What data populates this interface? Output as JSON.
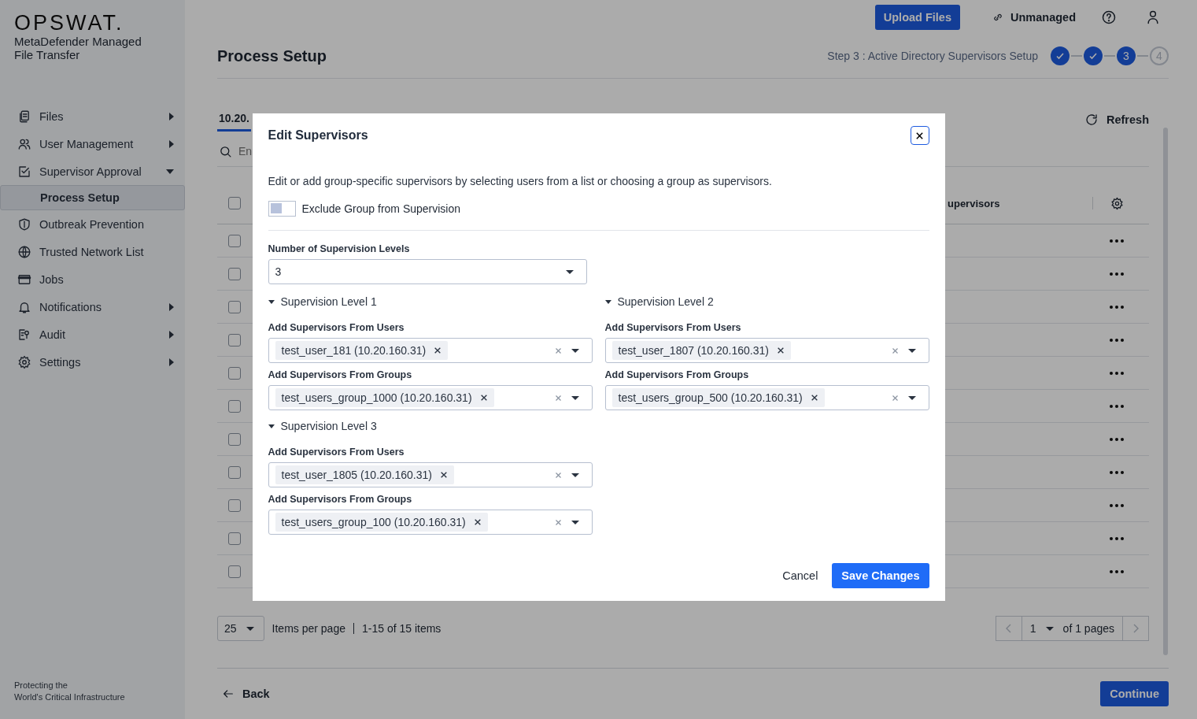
{
  "sidebar": {
    "logo": "OPSWAT.",
    "product": "MetaDefender Managed File Transfer",
    "items": [
      {
        "label": "Files",
        "expanded": false,
        "selected": false
      },
      {
        "label": "User Management",
        "expanded": false,
        "selected": false
      },
      {
        "label": "Supervisor Approval",
        "expanded": true,
        "selected": false,
        "children": [
          {
            "label": "Process Setup",
            "selected": true
          }
        ]
      },
      {
        "label": "Outbreak Prevention",
        "selected": false
      },
      {
        "label": "Trusted Network List",
        "selected": false
      },
      {
        "label": "Jobs",
        "selected": false
      },
      {
        "label": "Notifications",
        "expanded": false,
        "selected": false
      },
      {
        "label": "Audit",
        "expanded": false,
        "selected": false
      },
      {
        "label": "Settings",
        "expanded": false,
        "selected": false
      }
    ],
    "tagline": "Protecting the\nWorld's Critical Infrastructure"
  },
  "topbar": {
    "upload_button": "Upload Files",
    "status": "Unmanaged"
  },
  "page": {
    "title": "Process Setup",
    "step_label": "Step 3 : Active Directory Supervisors Setup",
    "steps": [
      {
        "kind": "done"
      },
      {
        "kind": "done"
      },
      {
        "kind": "current",
        "label": "3"
      },
      {
        "kind": "pending",
        "label": "4"
      }
    ]
  },
  "tab": {
    "label": "10.20.",
    "selected": true
  },
  "search": {
    "placeholder": "En"
  },
  "refresh": "Refresh",
  "table": {
    "column_header": "upervisors",
    "header_checked": false,
    "rows": [
      {
        "checked": false
      },
      {
        "checked": false
      },
      {
        "checked": false
      },
      {
        "checked": false
      },
      {
        "checked": false
      },
      {
        "checked": false
      },
      {
        "checked": false
      },
      {
        "checked": false
      },
      {
        "checked": false
      },
      {
        "checked": false
      },
      {
        "checked": false
      }
    ]
  },
  "pagination": {
    "page_size": "25",
    "items_label": "Items per page",
    "range": "1-15 of 15 items",
    "page": "1",
    "of_pages": "of 1 pages"
  },
  "footer": {
    "back": "Back",
    "continue": "Continue"
  },
  "dialog": {
    "title": "Edit Supervisors",
    "description": "Edit or add group-specific supervisors by selecting users from a list or choosing a group as supervisors.",
    "exclude_toggle": {
      "label": "Exclude Group from Supervision",
      "on": false
    },
    "levels_label": "Number of Supervision Levels",
    "levels_value": "3",
    "levels": [
      {
        "title": "Supervision Level 1",
        "expanded": true,
        "fields": [
          {
            "label": "Add Supervisors From Users",
            "tags": [
              "test_user_181 (10.20.160.31)"
            ]
          },
          {
            "label": "Add Supervisors From Groups",
            "tags": [
              "test_users_group_1000 (10.20.160.31)"
            ]
          }
        ]
      },
      {
        "title": "Supervision Level 2",
        "expanded": true,
        "fields": [
          {
            "label": "Add Supervisors From Users",
            "tags": [
              "test_user_1807 (10.20.160.31)"
            ]
          },
          {
            "label": "Add Supervisors From Groups",
            "tags": [
              "test_users_group_500 (10.20.160.31)"
            ]
          }
        ]
      },
      {
        "title": "Supervision Level 3",
        "expanded": true,
        "fields": [
          {
            "label": "Add Supervisors From Users",
            "tags": [
              "test_user_1805 (10.20.160.31)"
            ]
          },
          {
            "label": "Add Supervisors From Groups",
            "tags": [
              "test_users_group_100 (10.20.160.31)"
            ]
          }
        ]
      }
    ],
    "cancel": "Cancel",
    "save": "Save Changes"
  }
}
